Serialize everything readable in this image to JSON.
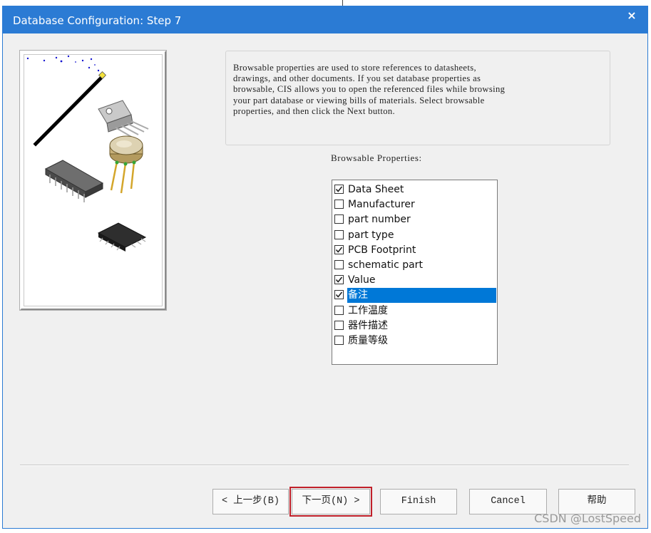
{
  "window": {
    "title": "Database Configuration: Step 7",
    "close_glyph": "×",
    "accent_color": "#2b7bd4"
  },
  "description": "Browsable properties are used to store references to datasheets,\ndrawings, and other documents. If you set database properties as\nbrowsable, CIS allows you to open the referenced files while browsing\nyour part database or viewing bills of materials. Select browsable\nproperties, and then click the Next button.",
  "properties": {
    "label": "Browsable Properties:",
    "items": [
      {
        "label": "Data Sheet",
        "checked": true,
        "selected": false
      },
      {
        "label": "Manufacturer",
        "checked": false,
        "selected": false
      },
      {
        "label": "part number",
        "checked": false,
        "selected": false
      },
      {
        "label": "part type",
        "checked": false,
        "selected": false
      },
      {
        "label": "PCB Footprint",
        "checked": true,
        "selected": false
      },
      {
        "label": "schematic part",
        "checked": false,
        "selected": false
      },
      {
        "label": "Value",
        "checked": true,
        "selected": false
      },
      {
        "label": "备注",
        "checked": true,
        "selected": true
      },
      {
        "label": "工作温度",
        "checked": false,
        "selected": false
      },
      {
        "label": "器件描述",
        "checked": false,
        "selected": false
      },
      {
        "label": "质量等级",
        "checked": false,
        "selected": false
      }
    ]
  },
  "buttons": {
    "back": "< 上一步(B)",
    "next": "下一页(N) >",
    "finish": "Finish",
    "cancel": "Cancel",
    "help": "帮助"
  },
  "highlight_color": "#c0202a",
  "watermark": "CSDN @LostSpeed"
}
